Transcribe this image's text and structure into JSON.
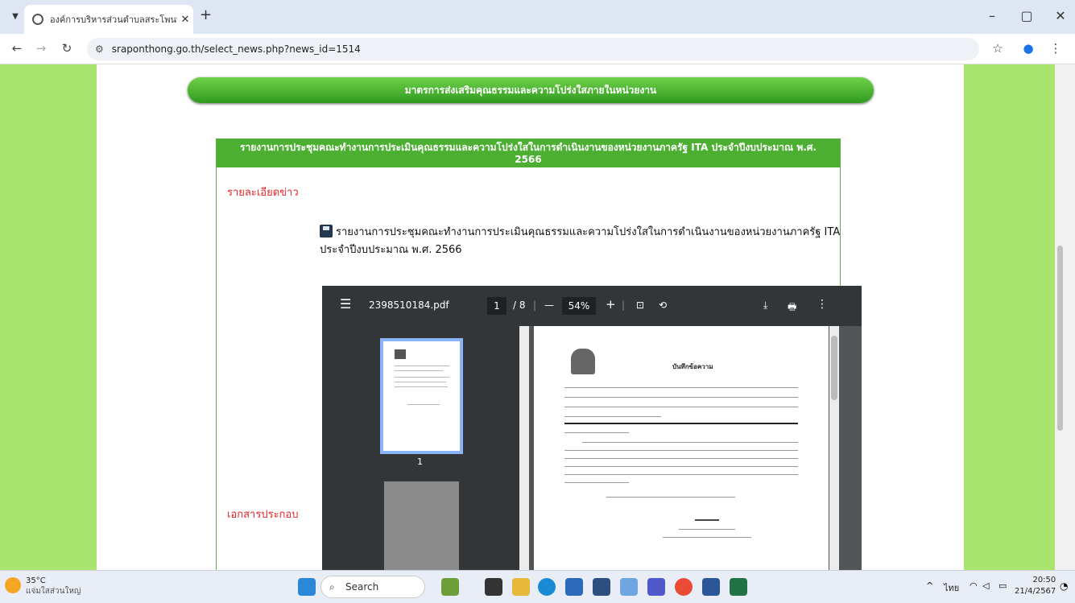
{
  "browser": {
    "tab_title": "องค์การบริหารส่วนตำบลสระโพนทอง",
    "url": "sraponthong.go.th/select_news.php?news_id=1514"
  },
  "page": {
    "green_button": "มาตรการส่งเสริมคุณธรรมและความโปร่งใสภายในหน่วยงาน",
    "panel_title_line1": "รายงานการประชุมคณะทำงานการประเมินคุณธรรมและความโปร่งใสในการดำเนินงานของหน่วยงานภาครัฐ ITA ประจำปีงบประมาณ พ.ศ.",
    "panel_title_line2": "2566",
    "news_detail_label": "รายละเอียดข่าว",
    "attachment_label": "เอกสารประกอบ",
    "file_link": "รายงานการประชุมคณะทำงานการประเมินคุณธรรมและความโปร่งใสในการดำเนินงานของหน่วยงานภาครัฐ ITA ประจำปีงบประมาณ พ.ศ. 2566"
  },
  "pdf": {
    "filename": "2398510184.pdf",
    "current_page": "1",
    "total_pages": "/ 8",
    "zoom": "54%",
    "thumb_number": "1",
    "doc_heading": "บันทึกข้อความ"
  },
  "taskbar": {
    "temp": "35°C",
    "weather_text": "แจ่มใสส่วนใหญ่",
    "search": "Search",
    "lang": "ไทย",
    "time": "20:50",
    "date": "21/4/2567"
  }
}
